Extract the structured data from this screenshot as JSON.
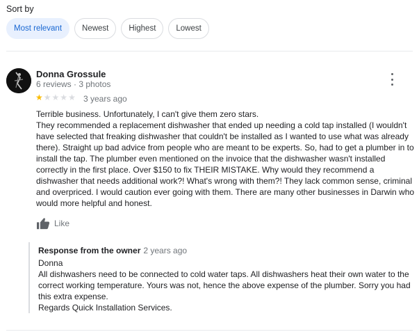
{
  "sort": {
    "label": "Sort by",
    "options": [
      "Most relevant",
      "Newest",
      "Highest",
      "Lowest"
    ],
    "selected": "Most relevant"
  },
  "review": {
    "author": "Donna Grossule",
    "meta": "6 reviews · 3 photos",
    "rating": 1,
    "rating_max": 5,
    "time": "3 years ago",
    "paragraphs": [
      "Terrible business. Unfortunately, I can't give them zero stars.",
      "They recommended a replacement dishwasher that ended up needing a cold tap installed (I wouldn't have selected that freaking dishwasher that couldn't be installed as I wanted to use what was already there). Straight up bad advice from people who are meant to be experts. So, had to get a plumber in to install the tap. The plumber even mentioned on the invoice that the dishwasher wasn't installed correctly in the first place. Over $150 to fix THEIR MISTAKE. Why would they recommend a dishwasher that needs additional work?! What's wrong with them?! They lack common sense, criminal and overpriced. I would caution ever going with them. There are many other businesses in Darwin who would more helpful and honest."
    ],
    "like_label": "Like",
    "owner_response": {
      "title": "Response from the owner",
      "time": "2 years ago",
      "lines": [
        "Donna",
        "All dishwashers need to be connected to cold water taps. All dishwashers heat their own water to the correct working temperature. Yours was not, hence the above expense of the plumber. Sorry you had this extra expense.",
        "Regards Quick Installation Services."
      ]
    }
  },
  "colors": {
    "star_filled": "#fbbc04",
    "star_empty": "#dadce0",
    "chip_active_bg": "#e8f0fe",
    "chip_active_text": "#1967d2"
  },
  "icons": {
    "more": "more-vert-icon",
    "like": "thumbs-up-icon",
    "star": "star-icon"
  }
}
